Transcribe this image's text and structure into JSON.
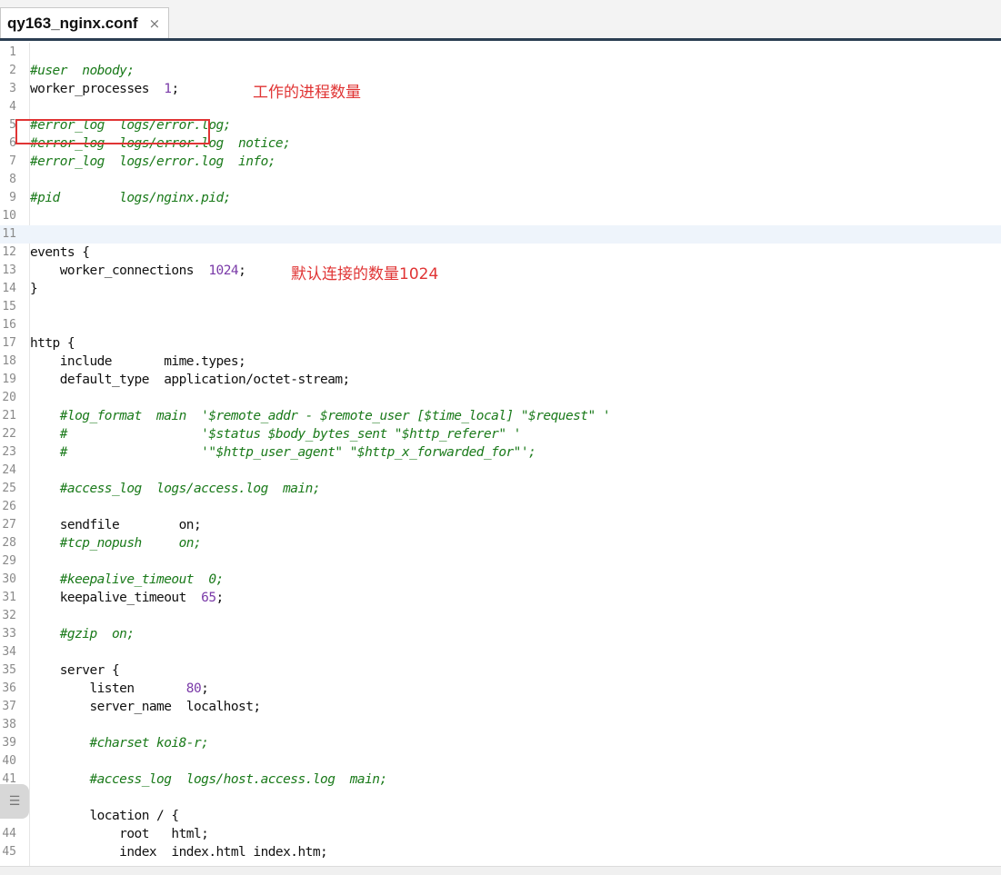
{
  "tab": {
    "title": "qy163_nginx.conf",
    "close_glyph": "×"
  },
  "annotations": {
    "worker_processes_note": "工作的进程数量",
    "worker_connections_note": "默认连接的数量1024"
  },
  "icons": {
    "side_handle": "☰"
  },
  "code_lines": [
    {
      "n": "1",
      "segments": []
    },
    {
      "n": "2",
      "segments": [
        {
          "t": "#user  nobody;",
          "k": "c"
        }
      ]
    },
    {
      "n": "3",
      "segments": [
        {
          "t": "worker_processes  ",
          "k": ""
        },
        {
          "t": "1",
          "k": "n"
        },
        {
          "t": ";",
          "k": ""
        }
      ]
    },
    {
      "n": "4",
      "segments": []
    },
    {
      "n": "5",
      "segments": [
        {
          "t": "#error_log  logs/error.log;",
          "k": "c"
        }
      ]
    },
    {
      "n": "6",
      "segments": [
        {
          "t": "#error_log  logs/error.log  notice;",
          "k": "c"
        }
      ]
    },
    {
      "n": "7",
      "segments": [
        {
          "t": "#error_log  logs/error.log  info;",
          "k": "c"
        }
      ]
    },
    {
      "n": "8",
      "segments": []
    },
    {
      "n": "9",
      "segments": [
        {
          "t": "#pid        logs/nginx.pid;",
          "k": "c"
        }
      ]
    },
    {
      "n": "10",
      "segments": []
    },
    {
      "n": "11",
      "segments": [],
      "active": true
    },
    {
      "n": "12",
      "segments": [
        {
          "t": "events {",
          "k": ""
        }
      ]
    },
    {
      "n": "13",
      "segments": [
        {
          "t": "    worker_connections  ",
          "k": ""
        },
        {
          "t": "1024",
          "k": "n"
        },
        {
          "t": ";",
          "k": ""
        }
      ]
    },
    {
      "n": "14",
      "segments": [
        {
          "t": "}",
          "k": ""
        }
      ]
    },
    {
      "n": "15",
      "segments": []
    },
    {
      "n": "16",
      "segments": []
    },
    {
      "n": "17",
      "segments": [
        {
          "t": "http {",
          "k": ""
        }
      ]
    },
    {
      "n": "18",
      "segments": [
        {
          "t": "    include       mime.types;",
          "k": ""
        }
      ]
    },
    {
      "n": "19",
      "segments": [
        {
          "t": "    default_type  application/octet-stream;",
          "k": ""
        }
      ]
    },
    {
      "n": "20",
      "segments": []
    },
    {
      "n": "21",
      "segments": [
        {
          "t": "    #log_format  main  '$remote_addr - $remote_user [$time_local] \"$request\" '",
          "k": "c"
        }
      ]
    },
    {
      "n": "22",
      "segments": [
        {
          "t": "    #                  '$status $body_bytes_sent \"$http_referer\" '",
          "k": "c"
        }
      ]
    },
    {
      "n": "23",
      "segments": [
        {
          "t": "    #                  '\"$http_user_agent\" \"$http_x_forwarded_for\"';",
          "k": "c"
        }
      ]
    },
    {
      "n": "24",
      "segments": []
    },
    {
      "n": "25",
      "segments": [
        {
          "t": "    #access_log  logs/access.log  main;",
          "k": "c"
        }
      ]
    },
    {
      "n": "26",
      "segments": []
    },
    {
      "n": "27",
      "segments": [
        {
          "t": "    sendfile        on;",
          "k": ""
        }
      ]
    },
    {
      "n": "28",
      "segments": [
        {
          "t": "    #tcp_nopush     on;",
          "k": "c"
        }
      ]
    },
    {
      "n": "29",
      "segments": []
    },
    {
      "n": "30",
      "segments": [
        {
          "t": "    #keepalive_timeout  0;",
          "k": "c"
        }
      ]
    },
    {
      "n": "31",
      "segments": [
        {
          "t": "    keepalive_timeout  ",
          "k": ""
        },
        {
          "t": "65",
          "k": "n"
        },
        {
          "t": ";",
          "k": ""
        }
      ]
    },
    {
      "n": "32",
      "segments": []
    },
    {
      "n": "33",
      "segments": [
        {
          "t": "    #gzip  on;",
          "k": "c"
        }
      ]
    },
    {
      "n": "34",
      "segments": []
    },
    {
      "n": "35",
      "segments": [
        {
          "t": "    server {",
          "k": ""
        }
      ]
    },
    {
      "n": "36",
      "segments": [
        {
          "t": "        listen       ",
          "k": ""
        },
        {
          "t": "80",
          "k": "n"
        },
        {
          "t": ";",
          "k": ""
        }
      ]
    },
    {
      "n": "37",
      "segments": [
        {
          "t": "        server_name  localhost;",
          "k": ""
        }
      ]
    },
    {
      "n": "38",
      "segments": []
    },
    {
      "n": "39",
      "segments": [
        {
          "t": "        #charset koi8-r;",
          "k": "c"
        }
      ]
    },
    {
      "n": "40",
      "segments": []
    },
    {
      "n": "41",
      "segments": [
        {
          "t": "        #access_log  logs/host.access.log  main;",
          "k": "c"
        }
      ]
    },
    {
      "n": "42",
      "segments": []
    },
    {
      "n": "43",
      "segments": [
        {
          "t": "        location / {",
          "k": ""
        }
      ]
    },
    {
      "n": "44",
      "segments": [
        {
          "t": "            root   html;",
          "k": ""
        }
      ]
    },
    {
      "n": "45",
      "segments": [
        {
          "t": "            index  index.html index.htm;",
          "k": ""
        }
      ]
    }
  ]
}
